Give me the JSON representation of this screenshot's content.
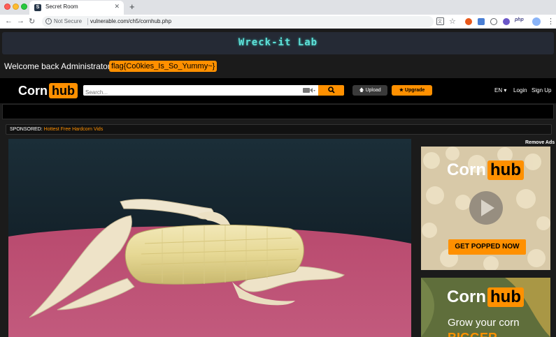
{
  "browser": {
    "tab_title": "Secret Room",
    "tab_close": "✕",
    "new_tab": "+",
    "security_label": "Not Secure",
    "url": "vulnerable.com/ch5/cornhub.php"
  },
  "page": {
    "lab_title": "Wreck-it Lab",
    "welcome_text": "Welcome back Administrator",
    "flag_text": "flag{Co0kies_Is_So_Yummy~}"
  },
  "site": {
    "logo_left": "Corn",
    "logo_right": "hub",
    "search_placeholder": "Search...",
    "upload_label": "🡅 Upload",
    "upgrade_label": "★ Upgrade",
    "lang_label": "EN ▾",
    "login_label": "Login",
    "signup_label": "Sign Up",
    "sponsored_label": "SPONSORED:",
    "sponsored_link": "Hottest Free Hardcorn Vids",
    "remove_ads": "Remove Ads"
  },
  "ads": {
    "ad1_logo_left": "Corn",
    "ad1_logo_right": "hub",
    "ad1_cta": "GET POPPED NOW",
    "ad2_logo_left": "Corn",
    "ad2_logo_right": "hub",
    "ad2_line1": "Grow your corn",
    "ad2_line2": "BIGGER"
  },
  "colors": {
    "accent": "#ff9000",
    "lab_title": "#5ee0d8",
    "page_bg": "#1b1b1b"
  },
  "icons": [
    "back-icon",
    "forward-icon",
    "reload-icon",
    "info-icon",
    "search-icon",
    "camera-icon",
    "translate-icon",
    "star-icon",
    "play-icon"
  ]
}
